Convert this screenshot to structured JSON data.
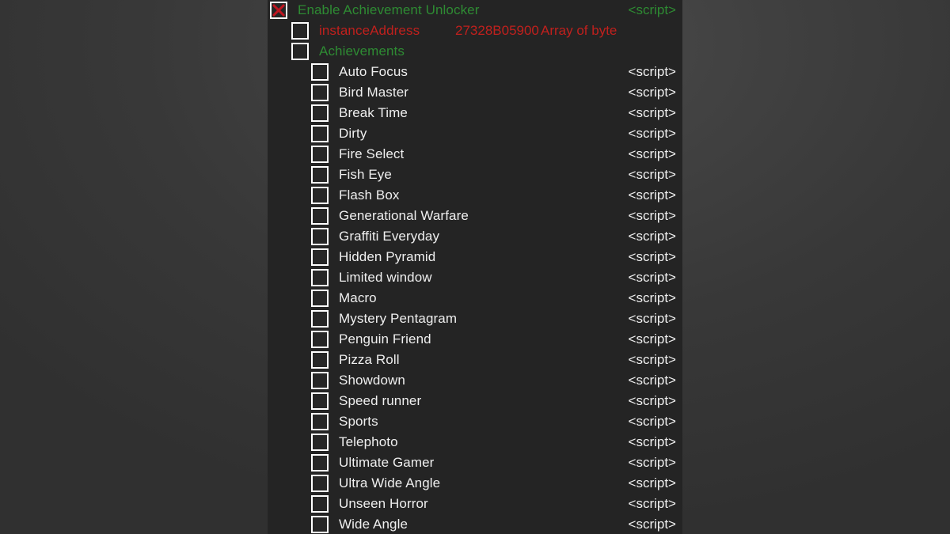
{
  "colors": {
    "panel_bg": "#242424",
    "desktop_bg": "#3a3a3a",
    "green": "#2e8b33",
    "red": "#c0201d",
    "white": "#efefef",
    "checkbox_x": "#c01520"
  },
  "table": {
    "root": {
      "label": "Enable Achievement Unlocker",
      "script_label": "<script>",
      "checked": true,
      "color": "green"
    },
    "instance_address": {
      "label": "instanceAddress",
      "address": "27328B05900",
      "type": "Array of byte",
      "checked": false,
      "color": "red"
    },
    "group": {
      "label": "Achievements",
      "checked": false,
      "color": "green"
    },
    "script_label": "<script>",
    "achievements": [
      {
        "label": "Auto Focus",
        "script": "<script>",
        "checked": false
      },
      {
        "label": "Bird Master",
        "script": "<script>",
        "checked": false
      },
      {
        "label": "Break Time",
        "script": "<script>",
        "checked": false
      },
      {
        "label": "Dirty",
        "script": "<script>",
        "checked": false
      },
      {
        "label": "Fire Select",
        "script": "<script>",
        "checked": false
      },
      {
        "label": "Fish Eye",
        "script": "<script>",
        "checked": false
      },
      {
        "label": "Flash Box",
        "script": "<script>",
        "checked": false
      },
      {
        "label": "Generational Warfare",
        "script": "<script>",
        "checked": false
      },
      {
        "label": "Graffiti Everyday",
        "script": "<script>",
        "checked": false
      },
      {
        "label": "Hidden Pyramid",
        "script": "<script>",
        "checked": false
      },
      {
        "label": "Limited window",
        "script": "<script>",
        "checked": false
      },
      {
        "label": "Macro",
        "script": "<script>",
        "checked": false
      },
      {
        "label": "Mystery Pentagram",
        "script": "<script>",
        "checked": false
      },
      {
        "label": "Penguin Friend",
        "script": "<script>",
        "checked": false
      },
      {
        "label": "Pizza Roll",
        "script": "<script>",
        "checked": false
      },
      {
        "label": "Showdown",
        "script": "<script>",
        "checked": false
      },
      {
        "label": "Speed runner",
        "script": "<script>",
        "checked": false
      },
      {
        "label": "Sports",
        "script": "<script>",
        "checked": false
      },
      {
        "label": "Telephoto",
        "script": "<script>",
        "checked": false
      },
      {
        "label": "Ultimate Gamer",
        "script": "<script>",
        "checked": false
      },
      {
        "label": "Ultra Wide Angle",
        "script": "<script>",
        "checked": false
      },
      {
        "label": "Unseen Horror",
        "script": "<script>",
        "checked": false
      },
      {
        "label": "Wide Angle",
        "script": "<script>",
        "checked": false
      }
    ]
  }
}
